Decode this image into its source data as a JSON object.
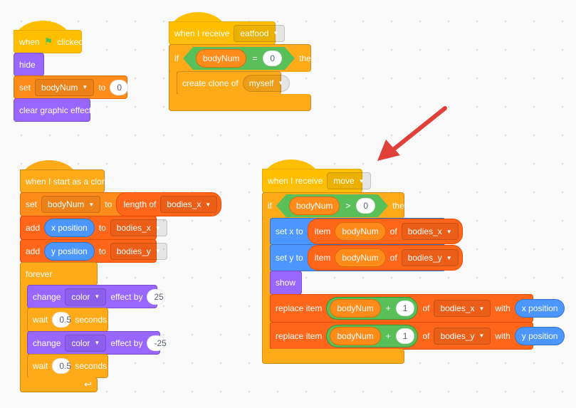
{
  "colors": {
    "events": "#ffbf00",
    "control": "#ffab19",
    "looks": "#9966ff",
    "variables": "#ff8c1a",
    "lists": "#ff661a",
    "operators": "#59c059",
    "motion": "#4c97ff",
    "arrow": "#e0403a"
  },
  "script1": {
    "hat": {
      "when": "when",
      "icon": "green-flag-icon",
      "clicked": "clicked"
    },
    "hide": "hide",
    "set": {
      "label": "set",
      "var": "bodyNum",
      "to": "to",
      "value": "0"
    },
    "clear": "clear graphic effects"
  },
  "script2": {
    "hat": {
      "label": "when I receive",
      "message": "eatfood"
    },
    "if": {
      "label": "if",
      "left": "bodyNum",
      "op": "=",
      "right": "0",
      "then": "then"
    },
    "clone": {
      "label": "create clone of",
      "target": "myself"
    }
  },
  "script3": {
    "hat": "when I start as a clone",
    "set": {
      "label": "set",
      "var": "bodyNum",
      "to": "to",
      "length_of": "length of",
      "list": "bodies_x"
    },
    "add1": {
      "label": "add",
      "value": "x position",
      "to": "to",
      "list": "bodies_x"
    },
    "add2": {
      "label": "add",
      "value": "y position",
      "to": "to",
      "list": "bodies_y"
    },
    "forever": "forever",
    "change1": {
      "label": "change",
      "effect": "color",
      "by": "effect by",
      "value": "25"
    },
    "wait1": {
      "label": "wait",
      "value": "0.5",
      "unit": "seconds"
    },
    "change2": {
      "label": "change",
      "effect": "color",
      "by": "effect by",
      "value": "-25"
    },
    "wait2": {
      "label": "wait",
      "value": "0.5",
      "unit": "seconds"
    },
    "loop_icon": "loop-arrow-icon"
  },
  "script4": {
    "hat": {
      "label": "when I receive",
      "message": "move"
    },
    "if": {
      "label": "if",
      "left": "bodyNum",
      "op": ">",
      "right": "0",
      "then": "then"
    },
    "setx": {
      "label": "set x to",
      "item": "item",
      "index": "bodyNum",
      "of": "of",
      "list": "bodies_x"
    },
    "sety": {
      "label": "set y to",
      "item": "item",
      "index": "bodyNum",
      "of": "of",
      "list": "bodies_y"
    },
    "show": "show",
    "replace1": {
      "label": "replace item",
      "index": "bodyNum",
      "plus": "+",
      "one": "1",
      "of": "of",
      "list": "bodies_x",
      "with": "with",
      "value": "x position"
    },
    "replace2": {
      "label": "replace item",
      "index": "bodyNum",
      "plus": "+",
      "one": "1",
      "of": "of",
      "list": "bodies_y",
      "with": "with",
      "value": "y position"
    }
  }
}
